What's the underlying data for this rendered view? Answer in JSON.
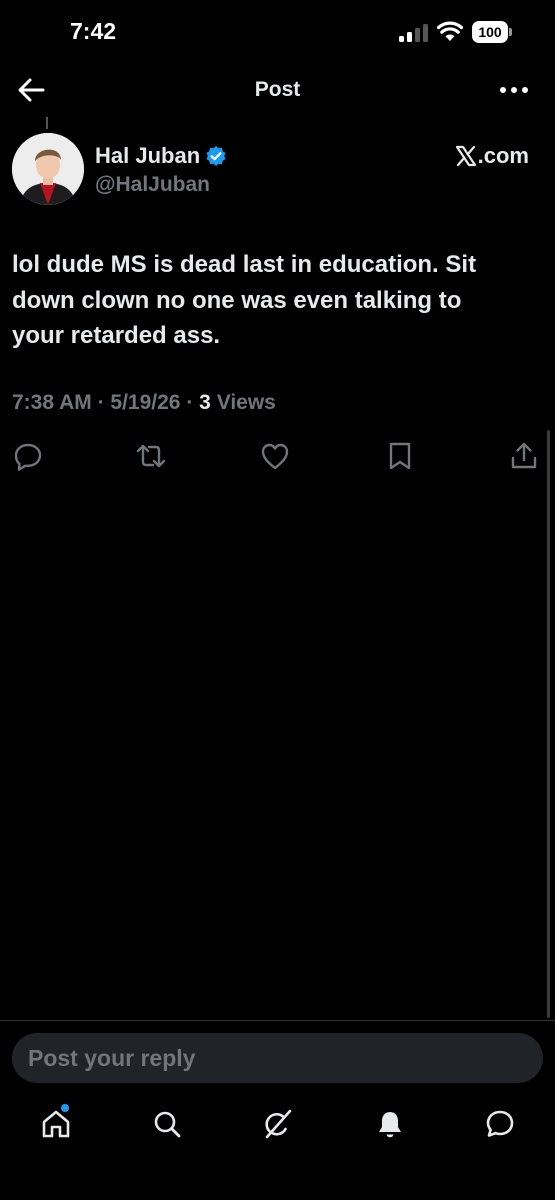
{
  "status_bar": {
    "time": "7:42",
    "battery": "100",
    "icons": [
      "signal-icon",
      "wifi-icon",
      "battery-icon"
    ]
  },
  "header": {
    "title": "Post",
    "back_icon": "arrow-left-icon",
    "more_icon": "more-horizontal-icon"
  },
  "post": {
    "author": {
      "display_name": "Hal Juban",
      "handle": "@HalJuban",
      "verified": true
    },
    "source": ".com",
    "source_logo": "x-logo-icon",
    "text": "lol dude MS is dead last in education. Sit\ndown clown no one was even  talking to\nyour retarded ass.",
    "time": "7:38 AM",
    "date": "5/19/26",
    "views_count": "3",
    "views_label": "Views",
    "actions": [
      "reply-icon",
      "repost-icon",
      "like-icon",
      "bookmark-icon",
      "share-icon"
    ]
  },
  "reply": {
    "placeholder": "Post your reply"
  },
  "tab_bar": {
    "items": [
      "home-icon",
      "search-icon",
      "grok-icon",
      "notifications-icon",
      "messages-icon"
    ]
  },
  "colors": {
    "background": "#000000",
    "text": "#e7e9ea",
    "muted": "#71767b",
    "accent": "#1d9bf0"
  }
}
